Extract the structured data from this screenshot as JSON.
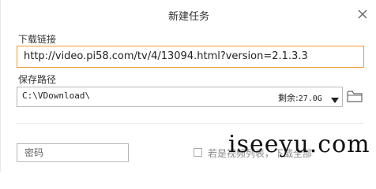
{
  "dialog": {
    "title": "新建任务",
    "url_label": "下载链接",
    "url_value": "http://video.pi58.com/tv/4/13094.html?version=2.1.3.3",
    "path_label": "保存路径",
    "path_value": "C:\\VDownload\\",
    "free_space_label": "剩余:",
    "free_space_value": "27.0G",
    "password_placeholder": "密码",
    "video_list_checkbox_label": "若是视频列表，下载全部",
    "video_list_checked": false
  },
  "watermark": "iseeyu.com",
  "colors": {
    "accent_border": "#f39a2e",
    "input_border": "#b7b7b7"
  },
  "icons": [
    "close-icon",
    "dropdown-arrow-icon",
    "folder-icon"
  ]
}
